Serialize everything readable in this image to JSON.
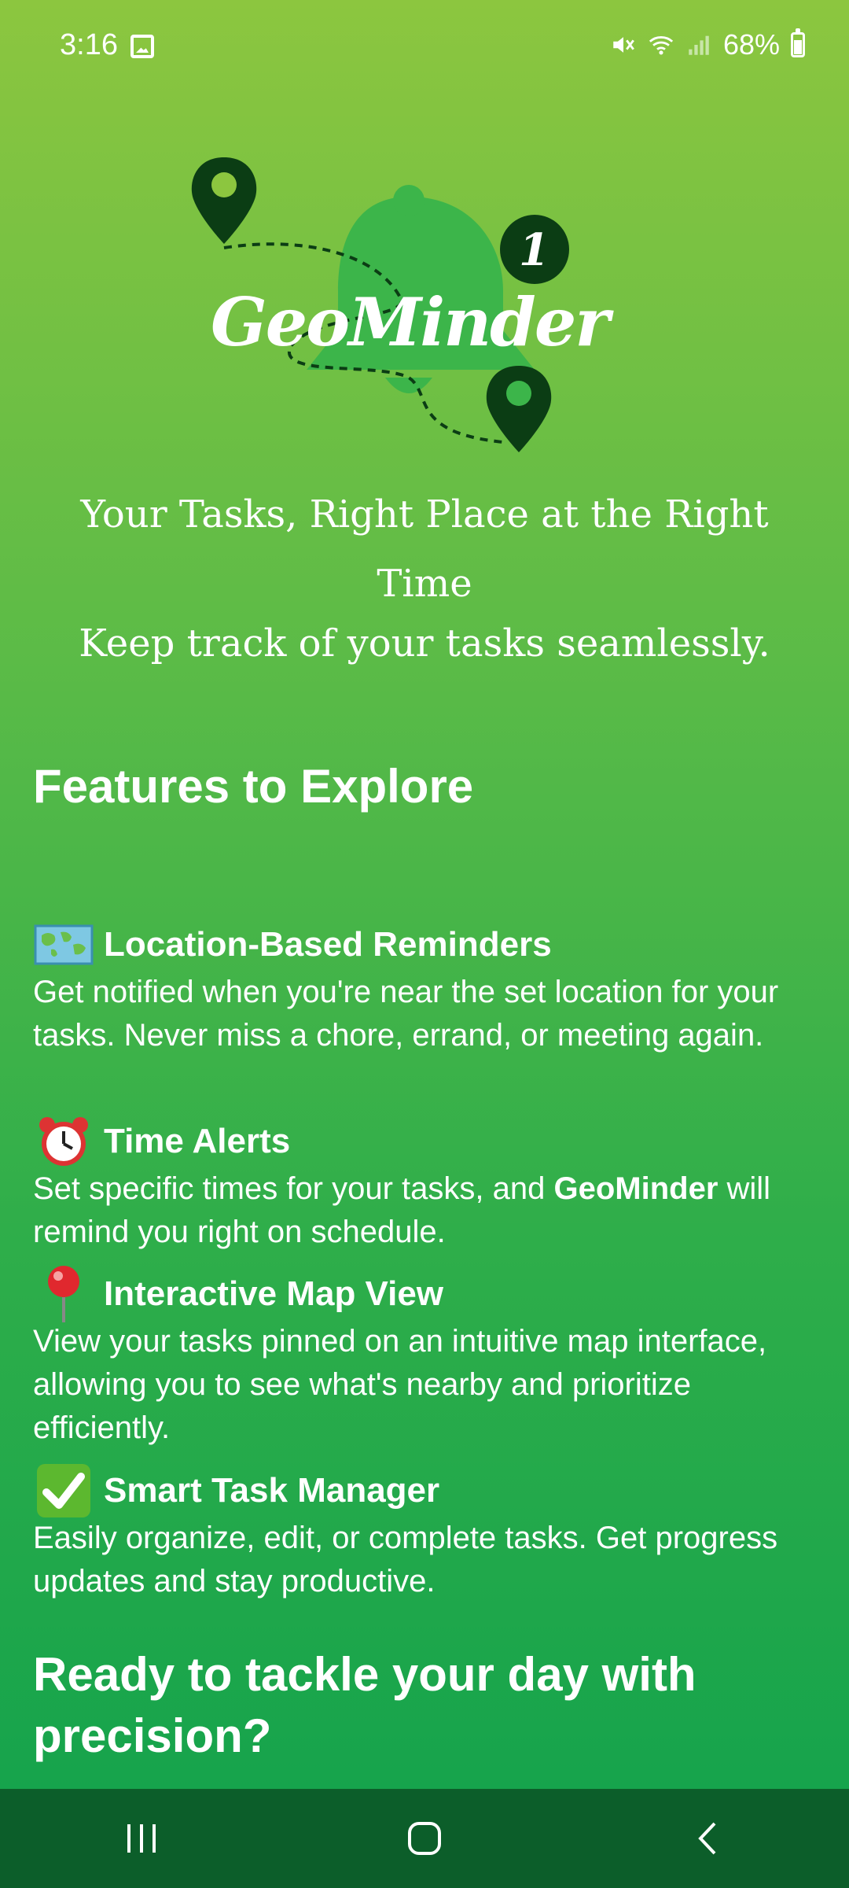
{
  "status": {
    "time": "3:16",
    "battery": "68%",
    "icons": [
      "gallery-icon",
      "mute-icon",
      "wifi-icon",
      "signal-icon",
      "battery-icon"
    ]
  },
  "logo": {
    "text": "GeoMinder",
    "badge": "1"
  },
  "tagline": "Your Tasks, Right Place at the Right Time",
  "subtagline": "Keep track of your tasks seamlessly.",
  "section_heading": "Features to Explore",
  "features": [
    {
      "icon": "world-map-icon",
      "title": "Location-Based Reminders",
      "desc": "Get notified when you're near the set location for your tasks. Never miss a chore, errand, or meeting again."
    },
    {
      "icon": "alarm-clock-icon",
      "title": "Time Alerts",
      "desc_prefix": "Set specific times for your tasks, and ",
      "desc_bold": "GeoMinder",
      "desc_suffix": " will remind you right on schedule."
    },
    {
      "icon": "pushpin-icon",
      "title": "Interactive Map View",
      "desc": "View your tasks pinned on an intuitive map interface, allowing you to see what's nearby and prioritize efficiently."
    },
    {
      "icon": "check-mark-icon",
      "title": "Smart Task Manager",
      "desc": "Easily organize, edit, or complete tasks. Get progress updates and stay productive."
    }
  ],
  "cta": "Ready to tackle your day with precision?",
  "colors": {
    "dark_green": "#0c5e2a",
    "pin_green": "#0b3d14",
    "bell_green": "#3cb54a",
    "accent_green": "#8cc63f"
  }
}
